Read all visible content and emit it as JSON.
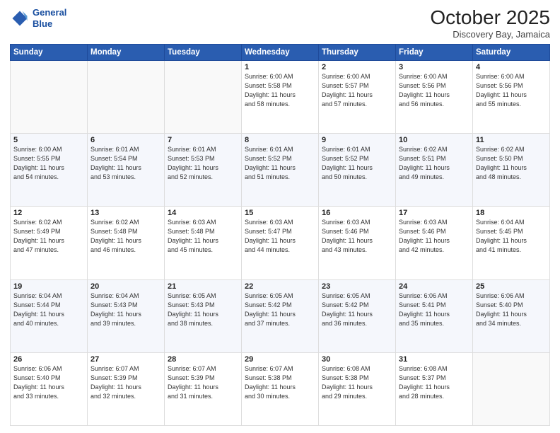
{
  "header": {
    "logo_line1": "General",
    "logo_line2": "Blue",
    "month": "October 2025",
    "location": "Discovery Bay, Jamaica"
  },
  "weekdays": [
    "Sunday",
    "Monday",
    "Tuesday",
    "Wednesday",
    "Thursday",
    "Friday",
    "Saturday"
  ],
  "weeks": [
    [
      {
        "day": "",
        "info": ""
      },
      {
        "day": "",
        "info": ""
      },
      {
        "day": "",
        "info": ""
      },
      {
        "day": "1",
        "info": "Sunrise: 6:00 AM\nSunset: 5:58 PM\nDaylight: 11 hours\nand 58 minutes."
      },
      {
        "day": "2",
        "info": "Sunrise: 6:00 AM\nSunset: 5:57 PM\nDaylight: 11 hours\nand 57 minutes."
      },
      {
        "day": "3",
        "info": "Sunrise: 6:00 AM\nSunset: 5:56 PM\nDaylight: 11 hours\nand 56 minutes."
      },
      {
        "day": "4",
        "info": "Sunrise: 6:00 AM\nSunset: 5:56 PM\nDaylight: 11 hours\nand 55 minutes."
      }
    ],
    [
      {
        "day": "5",
        "info": "Sunrise: 6:00 AM\nSunset: 5:55 PM\nDaylight: 11 hours\nand 54 minutes."
      },
      {
        "day": "6",
        "info": "Sunrise: 6:01 AM\nSunset: 5:54 PM\nDaylight: 11 hours\nand 53 minutes."
      },
      {
        "day": "7",
        "info": "Sunrise: 6:01 AM\nSunset: 5:53 PM\nDaylight: 11 hours\nand 52 minutes."
      },
      {
        "day": "8",
        "info": "Sunrise: 6:01 AM\nSunset: 5:52 PM\nDaylight: 11 hours\nand 51 minutes."
      },
      {
        "day": "9",
        "info": "Sunrise: 6:01 AM\nSunset: 5:52 PM\nDaylight: 11 hours\nand 50 minutes."
      },
      {
        "day": "10",
        "info": "Sunrise: 6:02 AM\nSunset: 5:51 PM\nDaylight: 11 hours\nand 49 minutes."
      },
      {
        "day": "11",
        "info": "Sunrise: 6:02 AM\nSunset: 5:50 PM\nDaylight: 11 hours\nand 48 minutes."
      }
    ],
    [
      {
        "day": "12",
        "info": "Sunrise: 6:02 AM\nSunset: 5:49 PM\nDaylight: 11 hours\nand 47 minutes."
      },
      {
        "day": "13",
        "info": "Sunrise: 6:02 AM\nSunset: 5:48 PM\nDaylight: 11 hours\nand 46 minutes."
      },
      {
        "day": "14",
        "info": "Sunrise: 6:03 AM\nSunset: 5:48 PM\nDaylight: 11 hours\nand 45 minutes."
      },
      {
        "day": "15",
        "info": "Sunrise: 6:03 AM\nSunset: 5:47 PM\nDaylight: 11 hours\nand 44 minutes."
      },
      {
        "day": "16",
        "info": "Sunrise: 6:03 AM\nSunset: 5:46 PM\nDaylight: 11 hours\nand 43 minutes."
      },
      {
        "day": "17",
        "info": "Sunrise: 6:03 AM\nSunset: 5:46 PM\nDaylight: 11 hours\nand 42 minutes."
      },
      {
        "day": "18",
        "info": "Sunrise: 6:04 AM\nSunset: 5:45 PM\nDaylight: 11 hours\nand 41 minutes."
      }
    ],
    [
      {
        "day": "19",
        "info": "Sunrise: 6:04 AM\nSunset: 5:44 PM\nDaylight: 11 hours\nand 40 minutes."
      },
      {
        "day": "20",
        "info": "Sunrise: 6:04 AM\nSunset: 5:43 PM\nDaylight: 11 hours\nand 39 minutes."
      },
      {
        "day": "21",
        "info": "Sunrise: 6:05 AM\nSunset: 5:43 PM\nDaylight: 11 hours\nand 38 minutes."
      },
      {
        "day": "22",
        "info": "Sunrise: 6:05 AM\nSunset: 5:42 PM\nDaylight: 11 hours\nand 37 minutes."
      },
      {
        "day": "23",
        "info": "Sunrise: 6:05 AM\nSunset: 5:42 PM\nDaylight: 11 hours\nand 36 minutes."
      },
      {
        "day": "24",
        "info": "Sunrise: 6:06 AM\nSunset: 5:41 PM\nDaylight: 11 hours\nand 35 minutes."
      },
      {
        "day": "25",
        "info": "Sunrise: 6:06 AM\nSunset: 5:40 PM\nDaylight: 11 hours\nand 34 minutes."
      }
    ],
    [
      {
        "day": "26",
        "info": "Sunrise: 6:06 AM\nSunset: 5:40 PM\nDaylight: 11 hours\nand 33 minutes."
      },
      {
        "day": "27",
        "info": "Sunrise: 6:07 AM\nSunset: 5:39 PM\nDaylight: 11 hours\nand 32 minutes."
      },
      {
        "day": "28",
        "info": "Sunrise: 6:07 AM\nSunset: 5:39 PM\nDaylight: 11 hours\nand 31 minutes."
      },
      {
        "day": "29",
        "info": "Sunrise: 6:07 AM\nSunset: 5:38 PM\nDaylight: 11 hours\nand 30 minutes."
      },
      {
        "day": "30",
        "info": "Sunrise: 6:08 AM\nSunset: 5:38 PM\nDaylight: 11 hours\nand 29 minutes."
      },
      {
        "day": "31",
        "info": "Sunrise: 6:08 AM\nSunset: 5:37 PM\nDaylight: 11 hours\nand 28 minutes."
      },
      {
        "day": "",
        "info": ""
      }
    ]
  ]
}
